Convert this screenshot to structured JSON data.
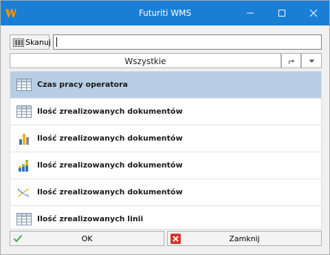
{
  "window": {
    "title": "Futuriti WMS",
    "accent_color": "#1a7fd4",
    "icons": [
      "app-logo-icon",
      "minimize-icon",
      "maximize-icon",
      "close-icon"
    ]
  },
  "scan": {
    "button_label": "Skanuj",
    "button_icon": "barcode-icon",
    "input_value": ""
  },
  "filter": {
    "selected": "Wszystkie",
    "icons": [
      "redirect-arrow-icon",
      "chevron-down-icon"
    ]
  },
  "list": {
    "selected_color": "#b7cde3",
    "items": [
      {
        "label": "Czas pracy operatora",
        "icon": "table-grid-icon",
        "selected": true
      },
      {
        "label": "Ilość zrealizowanych dokumentów",
        "icon": "table-grid-icon",
        "selected": false
      },
      {
        "label": "Ilość zrealizowanych dokumentów",
        "icon": "bar-chart-icon",
        "selected": false
      },
      {
        "label": "Ilość zrealizowanych dokumentów",
        "icon": "stacked-bar-chart-icon",
        "selected": false
      },
      {
        "label": "Ilość zrealizowanych dokumentów",
        "icon": "line-chart-icon",
        "selected": false
      },
      {
        "label": "Ilość zrealizowanych linii",
        "icon": "table-grid-icon",
        "selected": false
      }
    ]
  },
  "buttons": {
    "ok_label": "OK",
    "ok_icon": "checkmark-icon",
    "close_label": "Zamknij",
    "close_icon": "red-x-icon"
  }
}
